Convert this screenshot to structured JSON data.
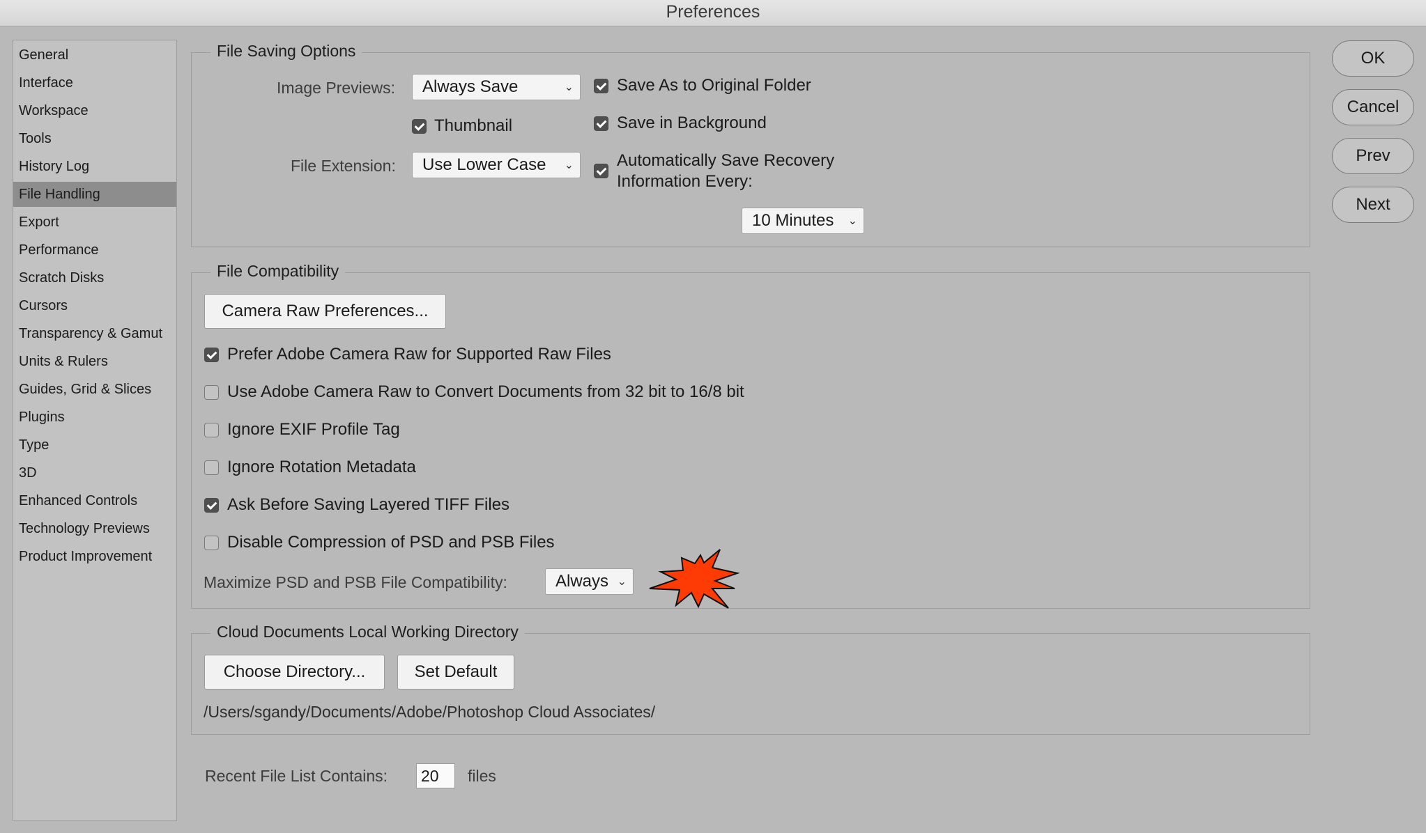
{
  "window": {
    "title": "Preferences"
  },
  "sidebar": {
    "items": [
      {
        "label": "General"
      },
      {
        "label": "Interface"
      },
      {
        "label": "Workspace"
      },
      {
        "label": "Tools"
      },
      {
        "label": "History Log"
      },
      {
        "label": "File Handling"
      },
      {
        "label": "Export"
      },
      {
        "label": "Performance"
      },
      {
        "label": "Scratch Disks"
      },
      {
        "label": "Cursors"
      },
      {
        "label": "Transparency & Gamut"
      },
      {
        "label": "Units & Rulers"
      },
      {
        "label": "Guides, Grid & Slices"
      },
      {
        "label": "Plugins"
      },
      {
        "label": "Type"
      },
      {
        "label": "3D"
      },
      {
        "label": "Enhanced Controls"
      },
      {
        "label": "Technology Previews"
      },
      {
        "label": "Product Improvement"
      }
    ],
    "selected": "File Handling"
  },
  "file_saving": {
    "legend": "File Saving Options",
    "image_previews_label": "Image Previews:",
    "image_previews_value": "Always Save",
    "thumbnail_label": "Thumbnail",
    "thumbnail_checked": true,
    "file_extension_label": "File Extension:",
    "file_extension_value": "Use Lower Case",
    "save_as_original_label": "Save As to Original Folder",
    "save_as_original_checked": true,
    "save_background_label": "Save in Background",
    "save_background_checked": true,
    "auto_recovery_label_1": "Automatically Save Recovery",
    "auto_recovery_label_2": "Information Every:",
    "auto_recovery_checked": true,
    "auto_recovery_interval": "10 Minutes"
  },
  "file_compat": {
    "legend": "File Compatibility",
    "camera_raw_button": "Camera Raw Preferences...",
    "options": [
      {
        "label": "Prefer Adobe Camera Raw for Supported Raw Files",
        "checked": true
      },
      {
        "label": "Use Adobe Camera Raw to Convert Documents from 32 bit to 16/8 bit",
        "checked": false
      },
      {
        "label": "Ignore EXIF Profile Tag",
        "checked": false
      },
      {
        "label": "Ignore Rotation Metadata",
        "checked": false
      },
      {
        "label": "Ask Before Saving Layered TIFF Files",
        "checked": true
      },
      {
        "label": "Disable Compression of PSD and PSB Files",
        "checked": false
      }
    ],
    "maximize_label": "Maximize PSD and PSB File Compatibility:",
    "maximize_value": "Always"
  },
  "cloud": {
    "legend": "Cloud Documents Local Working Directory",
    "choose_button": "Choose Directory...",
    "default_button": "Set Default",
    "path": "/Users/sgandy/Documents/Adobe/Photoshop Cloud Associates/"
  },
  "recent": {
    "label": "Recent File List Contains:",
    "value": "20",
    "suffix": "files"
  },
  "buttons": {
    "ok": "OK",
    "cancel": "Cancel",
    "prev": "Prev",
    "next": "Next"
  },
  "annotation": {
    "color": "#ff3b05"
  },
  "icons": {
    "dropdown": "chevron-down-icon",
    "checkbox_on": "checkmark-icon",
    "annotation": "starburst-icon"
  }
}
